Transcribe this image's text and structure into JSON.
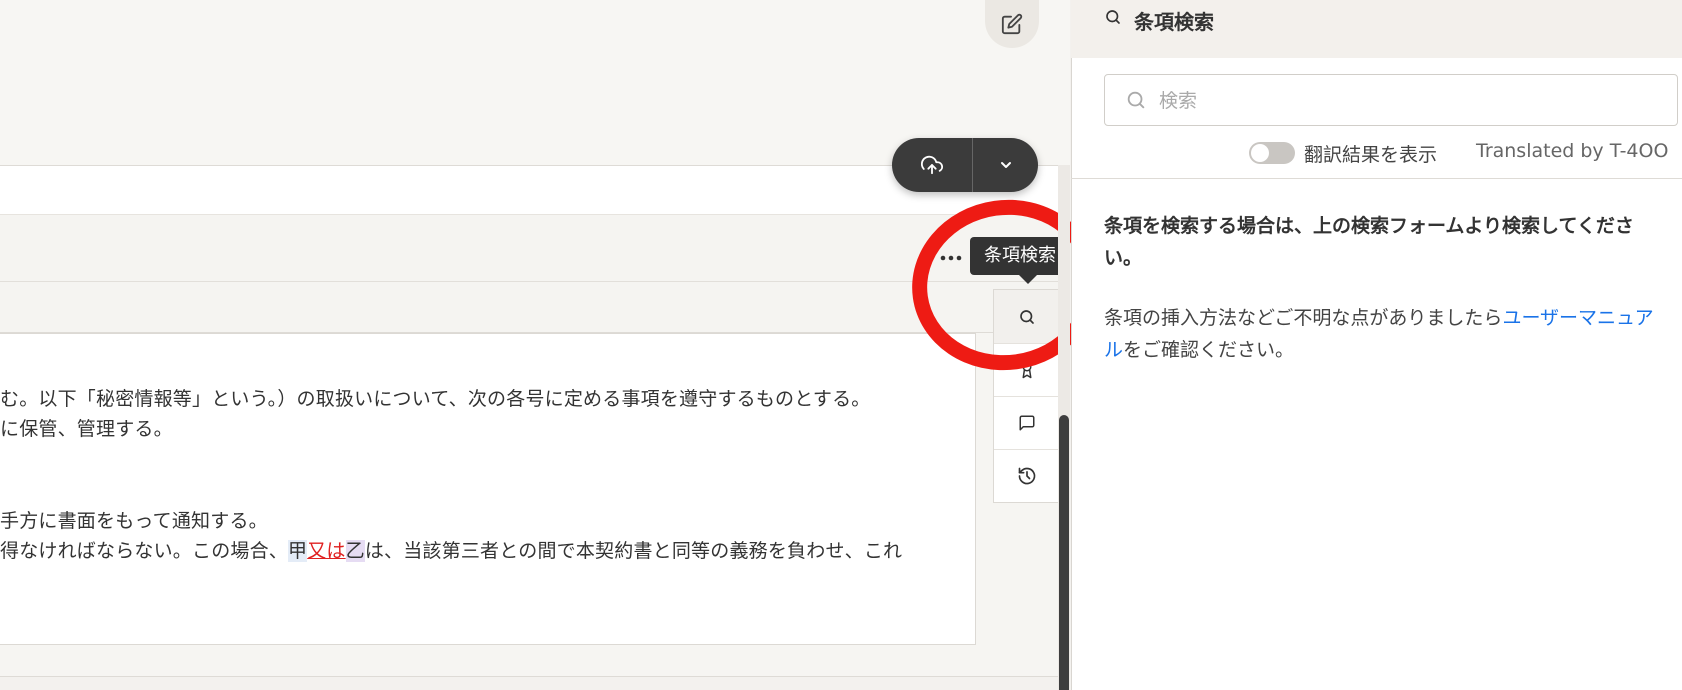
{
  "toolbar": {
    "edit_icon": "edit-icon",
    "upload_icon": "cloud-upload-icon",
    "dropdown_icon": "chevron-down-icon",
    "more_icon": "more-horizontal-icon"
  },
  "document": {
    "lines": [
      "む。以下「秘密情報等」という。）の取扱いについて、次の各号に定める事項を遵守するものとする。",
      "に保管、管理する。",
      "手方に書面をもって通知する。"
    ],
    "line4": {
      "before": "得なければならない。この場合、",
      "party_a": "甲",
      "conjunction": "又は",
      "party_b": "乙",
      "after": "は、当該第三者との間で本契約書と同等の義務を負わせ、これ"
    }
  },
  "tooltip": {
    "text": "条項検索"
  },
  "side_tools": [
    {
      "name": "search-icon",
      "active": true
    },
    {
      "name": "bookmark-icon",
      "active": false
    },
    {
      "name": "comment-icon",
      "active": false
    },
    {
      "name": "history-icon",
      "active": false
    }
  ],
  "panel": {
    "title": "条項検索",
    "search_placeholder": "検索",
    "toggle_label": "翻訳結果を表示",
    "toggle_on": false,
    "translated_by": "Translated by T-4OO",
    "help_bold": "条項を検索する場合は、上の検索フォームより検索してください。",
    "help_text_before": "条項の挿入方法などご不明な点がありましたら",
    "help_link": "ユーザーマニュアル",
    "help_text_after": "をご確認ください。"
  },
  "colors": {
    "annotation_circle": "#ee1b14",
    "link": "#1a73e8",
    "highlight_red": "#e02020"
  }
}
